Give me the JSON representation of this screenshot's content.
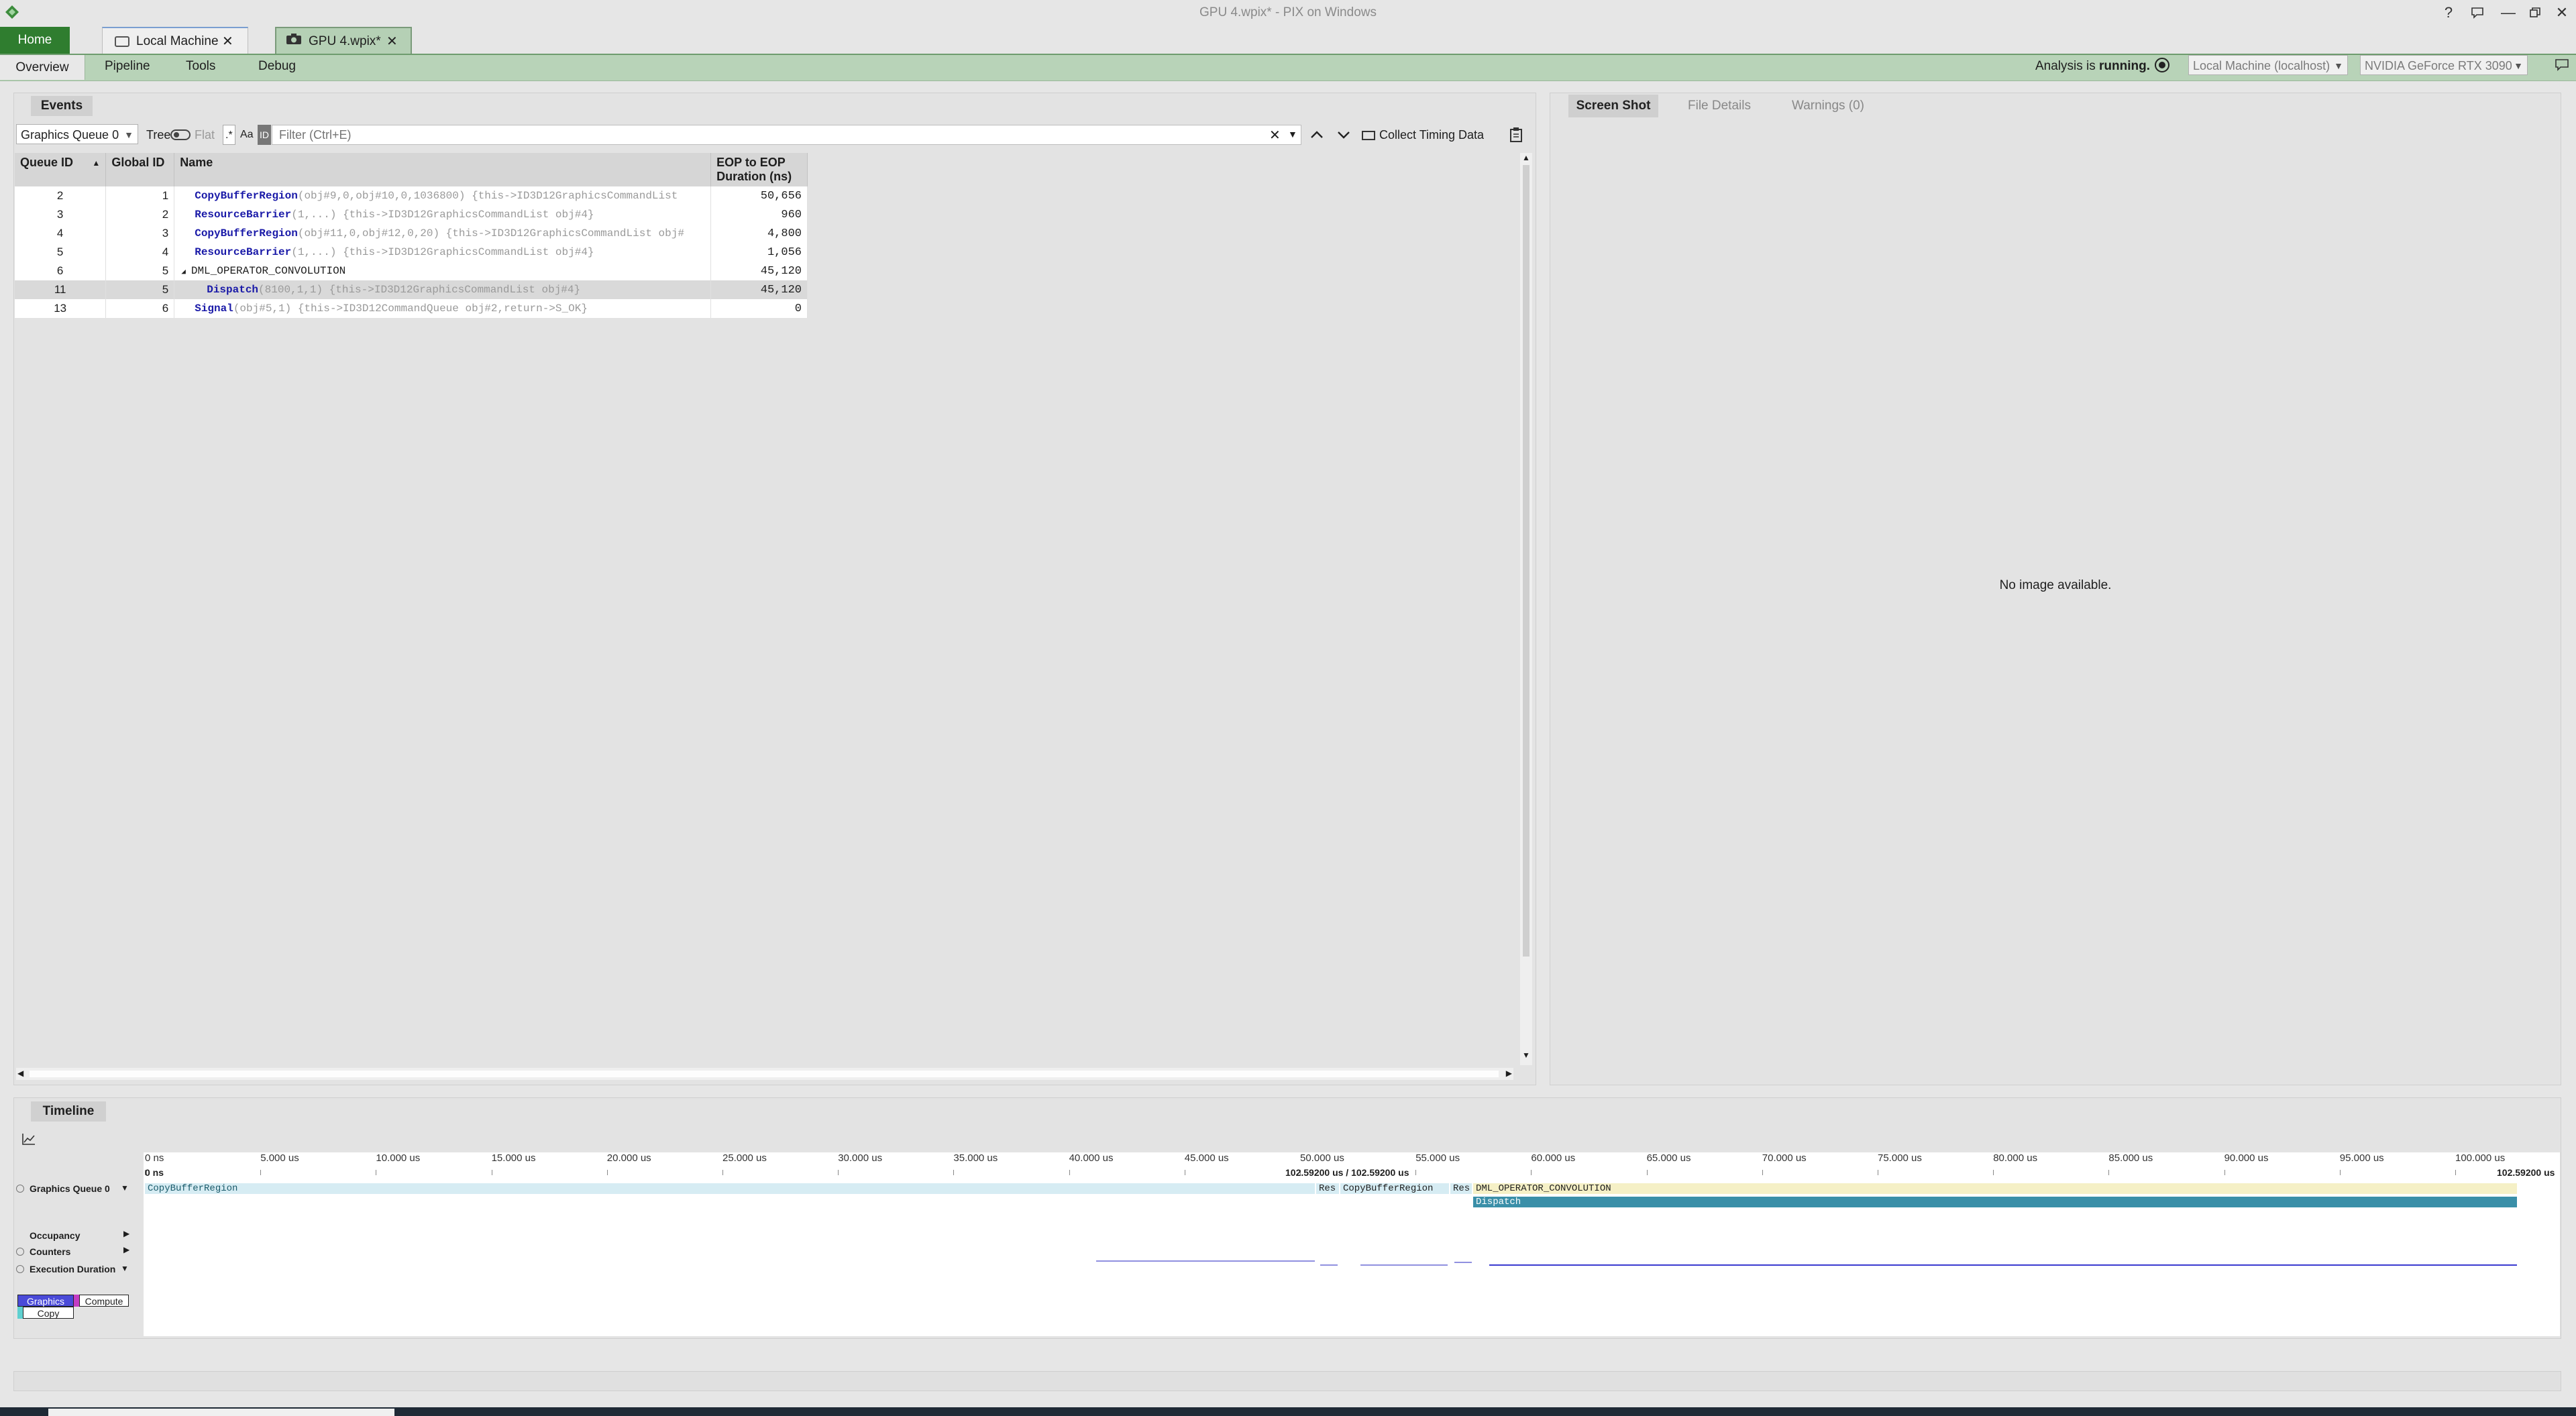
{
  "window": {
    "title": "GPU 4.wpix* - PIX on Windows",
    "colors": {
      "home_tab": "#2f7d2f",
      "accent_green": "#b8d3b8",
      "name_blue": "#1a1aa8"
    }
  },
  "tabs": {
    "home": "Home",
    "local": "Local Machine",
    "gpu": "GPU 4.wpix*",
    "close_glyph": "✕"
  },
  "subnav": {
    "items": [
      "Overview",
      "Pipeline",
      "Tools",
      "Debug"
    ],
    "analysis_prefix": "Analysis is",
    "analysis_state": "running.",
    "machine": "Local Machine (localhost)",
    "gpu": "NVIDIA GeForce RTX 3090"
  },
  "events": {
    "panel_title": "Events",
    "queue_select": "Graphics Queue 0",
    "tree_label": "Tree",
    "flat_label": "Flat",
    "regex_label": ".*",
    "case_label": "Aa",
    "id_label": "ID",
    "filter_placeholder": "Filter (Ctrl+E)",
    "collect_timing": "Collect Timing Data",
    "columns": {
      "queue_id": "Queue ID",
      "global_id": "Global ID",
      "name": "Name",
      "eop_line1": "EOP to EOP",
      "eop_line2": "Duration (ns)"
    },
    "rows": [
      {
        "queue_id": "2",
        "global_id": "1",
        "fn": "CopyBufferRegion",
        "args": "(obj#9,0,obj#10,0,1036800)  {this->ID3D12GraphicsCommandList",
        "duration": "50,656"
      },
      {
        "queue_id": "3",
        "global_id": "2",
        "fn": "ResourceBarrier",
        "args": "(1,...)  {this->ID3D12GraphicsCommandList obj#4}",
        "duration": "960"
      },
      {
        "queue_id": "4",
        "global_id": "3",
        "fn": "CopyBufferRegion",
        "args": "(obj#11,0,obj#12,0,20)  {this->ID3D12GraphicsCommandList obj#",
        "duration": "4,800"
      },
      {
        "queue_id": "5",
        "global_id": "4",
        "fn": "ResourceBarrier",
        "args": "(1,...)  {this->ID3D12GraphicsCommandList obj#4}",
        "duration": "1,056"
      },
      {
        "queue_id": "6",
        "global_id": "5",
        "fn": "DML_OPERATOR_CONVOLUTION",
        "args": "",
        "duration": "45,120"
      },
      {
        "queue_id": "11",
        "global_id": "5",
        "fn": "Dispatch",
        "args": "(8100,1,1)  {this->ID3D12GraphicsCommandList obj#4}",
        "duration": "45,120"
      },
      {
        "queue_id": "13",
        "global_id": "6",
        "fn": "Signal",
        "args": "(obj#5,1)  {this->ID3D12CommandQueue obj#2,return->S_OK}",
        "duration": "0"
      }
    ]
  },
  "right_panel": {
    "tabs": [
      "Screen Shot",
      "File Details",
      "Warnings (0)"
    ],
    "message": "No image available."
  },
  "timeline": {
    "title": "Timeline",
    "ticks": [
      "0 ns",
      "5.000 us",
      "10.000 us",
      "15.000 us",
      "20.000 us",
      "25.000 us",
      "30.000 us",
      "35.000 us",
      "40.000 us",
      "45.000 us",
      "50.000 us",
      "55.000 us",
      "60.000 us",
      "65.000 us",
      "70.000 us",
      "75.000 us",
      "80.000 us",
      "85.000 us",
      "90.000 us",
      "95.000 us",
      "100.000 us"
    ],
    "range_start": "0 ns",
    "range_mid": "102.59200 us / 102.59200 us",
    "range_end": "102.59200 us",
    "lanes": {
      "queue": "Graphics Queue 0",
      "occupancy": "Occupancy",
      "counters": "Counters",
      "exec_duration": "Execution Duration"
    },
    "bars": {
      "copy_buffer": "CopyBufferRegion",
      "res1": "Res",
      "copy_buffer2": "CopyBufferRegion",
      "res2": "Res",
      "dml": "DML_OPERATOR_CONVOLUTION",
      "dispatch": "Dispatch"
    },
    "legend": {
      "graphics": "Graphics",
      "compute": "Compute",
      "copy": "Copy"
    },
    "legend_colors": {
      "graphics": "#4a4ad8",
      "compute": "#c43cc4",
      "copy": "#5fd0d0"
    }
  }
}
